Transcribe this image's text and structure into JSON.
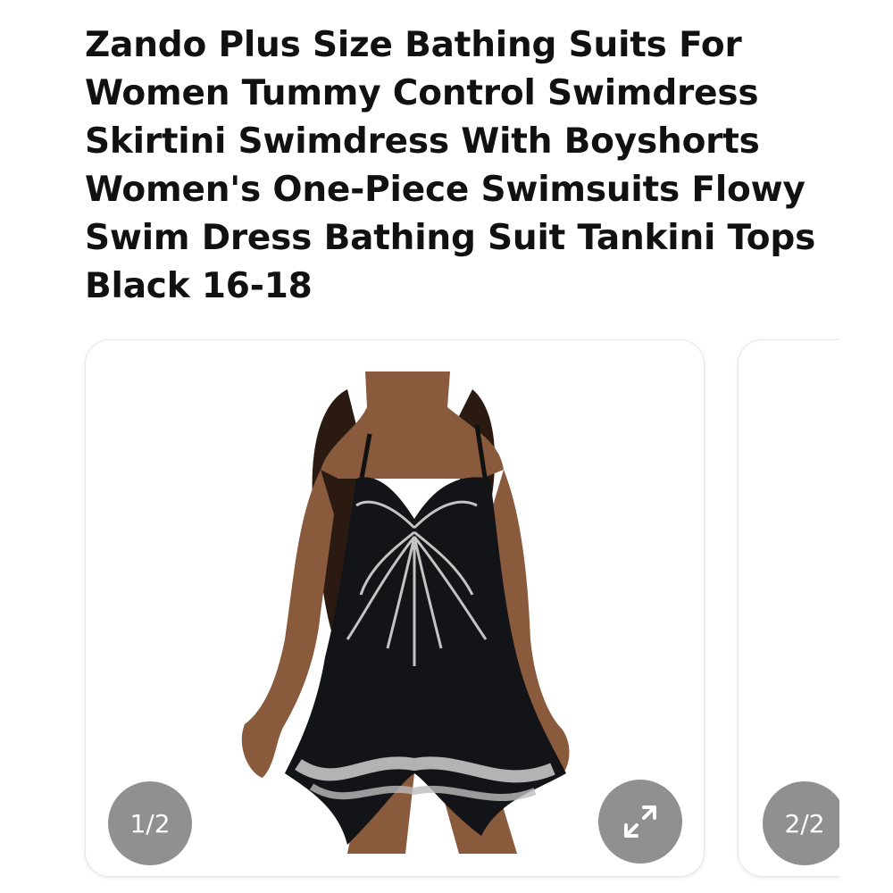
{
  "product": {
    "title": "Zando Plus Size Bathing Suits For Women Tummy Control Swimdress Skirtini Swimdress With Boyshorts Women's One-Piece Swimsuits Flowy Swim Dress Bathing Suit Tankini Tops Black 16-18"
  },
  "gallery": {
    "slides": [
      {
        "counter": "1/2"
      },
      {
        "counter": "2/2"
      }
    ],
    "expand_icon": "expand-arrows-icon"
  },
  "colors": {
    "badge_bg": "#787878",
    "card_border": "#e7e7e7",
    "title_text": "#111111"
  }
}
